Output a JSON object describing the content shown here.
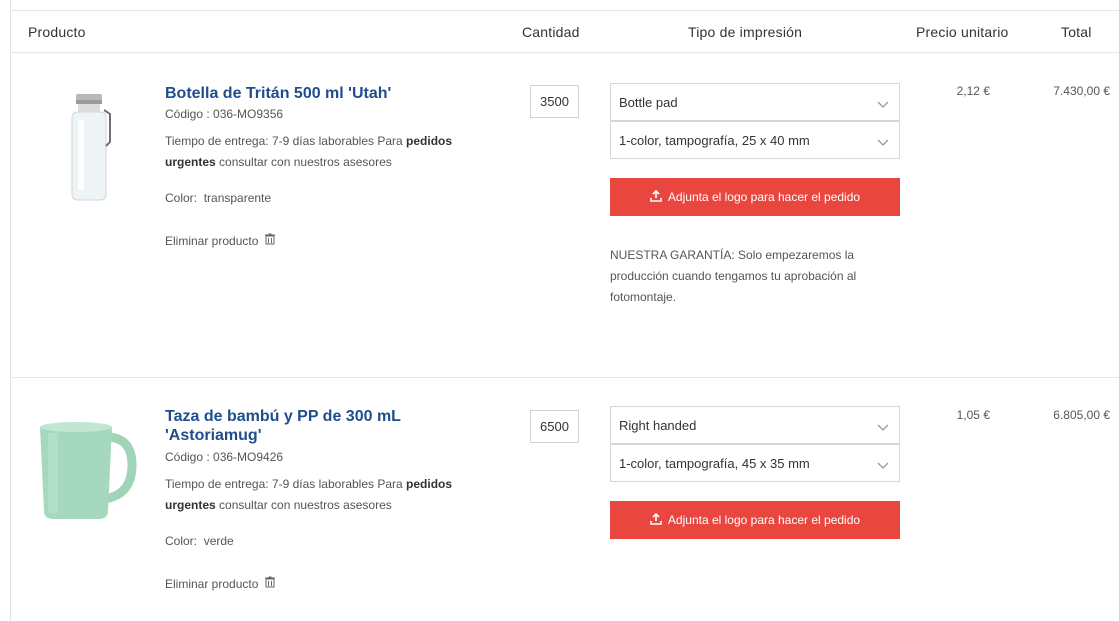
{
  "header": {
    "product": "Producto",
    "quantity": "Cantidad",
    "print_type": "Tipo de impresión",
    "unit_price": "Precio unitario",
    "total": "Total"
  },
  "items": [
    {
      "name": "Botella de Tritán 500 ml 'Utah'",
      "code": "Código : 036-MO9356",
      "delivery_prefix": "Tiempo de entrega: 7-9 días laborables Para ",
      "delivery_bold1": "pedidos",
      "delivery_bold2": "urgentes",
      "delivery_suffix": " consultar con nuestros asesores",
      "color_label": "Color:",
      "color_value": "transparente",
      "remove_label": "Eliminar producto",
      "quantity": "3500",
      "print_option": "Bottle pad",
      "print_method": "1-color, tampografía, 25 x 40 mm",
      "upload_label": "Adjunta el logo para hacer el pedido",
      "guarantee": "NUESTRA GARANTÍA: Solo empezaremos la producción cuando tengamos tu aprobación al fotomontaje.",
      "unit_price": "2,12 €",
      "total": "7.430,00 €"
    },
    {
      "name": "Taza de bambú y PP de 300 mL 'Astoriamug'",
      "code": "Código : 036-MO9426",
      "delivery_prefix": "Tiempo de entrega: 7-9 días laborables Para ",
      "delivery_bold1": "pedidos",
      "delivery_bold2": "urgentes",
      "delivery_suffix": " consultar con nuestros asesores",
      "color_label": "Color:",
      "color_value": "verde",
      "remove_label": "Eliminar producto",
      "quantity": "6500",
      "print_option": "Right handed",
      "print_method": "1-color, tampografía, 45 x 35 mm",
      "upload_label": "Adjunta el logo para hacer el pedido",
      "unit_price": "1,05 €",
      "total": "6.805,00 €"
    }
  ],
  "colors": {
    "accent_button": "#e8463f",
    "product_link": "#1f4d8e",
    "mug_green": "#9fd4b9"
  }
}
